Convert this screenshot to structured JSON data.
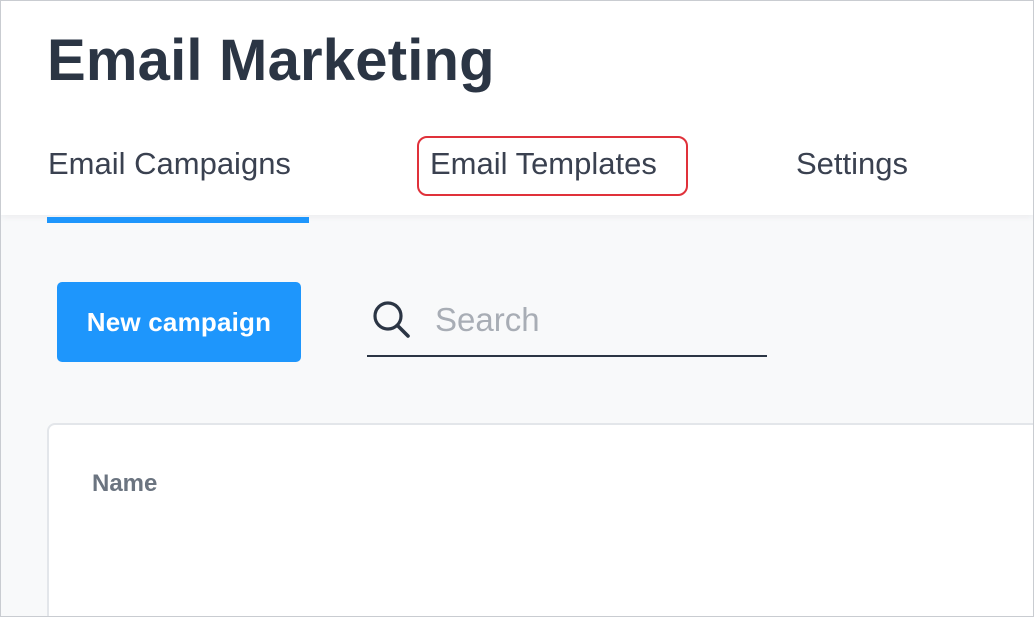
{
  "header": {
    "title": "Email Marketing"
  },
  "tabs": [
    {
      "label": "Email Campaigns",
      "active": true
    },
    {
      "label": "Email Templates",
      "active": false,
      "highlighted": true
    },
    {
      "label": "Settings",
      "active": false
    }
  ],
  "toolbar": {
    "new_campaign_label": "New campaign",
    "search": {
      "placeholder": "Search",
      "value": "",
      "icon": "search-icon"
    }
  },
  "table": {
    "columns": [
      "Name"
    ]
  },
  "colors": {
    "accent": "#1e96fc",
    "title": "#2b3544",
    "highlight": "#e0313a"
  }
}
